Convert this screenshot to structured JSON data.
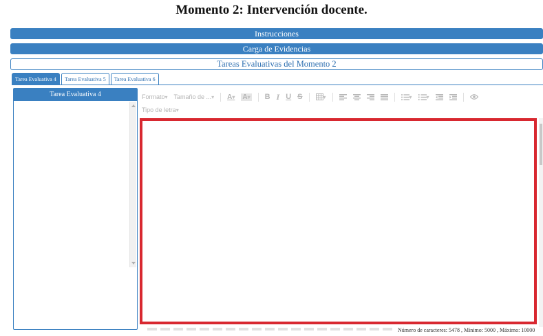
{
  "page": {
    "title": "Momento 2: Intervención docente."
  },
  "sections": {
    "instructions": "Instrucciones",
    "evidence": "Carga de Evidencias",
    "tasks": "Tareas Evaluativas del Momento 2"
  },
  "tabs": [
    {
      "label": "Tarea Evaluativa 4",
      "active": true
    },
    {
      "label": "Tarea Evaluativa 5",
      "active": false
    },
    {
      "label": "Tarea Evaluativa 6",
      "active": false
    }
  ],
  "left_panel": {
    "header": "Tarea Evaluativa 4"
  },
  "toolbar": {
    "format": "Formato",
    "size": "Tamaño de ...",
    "font_type": "Tipo de letra",
    "bold": "B",
    "italic": "I",
    "underline": "U",
    "strike": "S"
  },
  "status": {
    "text": "Número de caracteres: 5478 , Mínimo: 5000 , Máximo: 10000"
  },
  "colors": {
    "accent": "#3a80c1",
    "editor_border": "#d82830"
  }
}
